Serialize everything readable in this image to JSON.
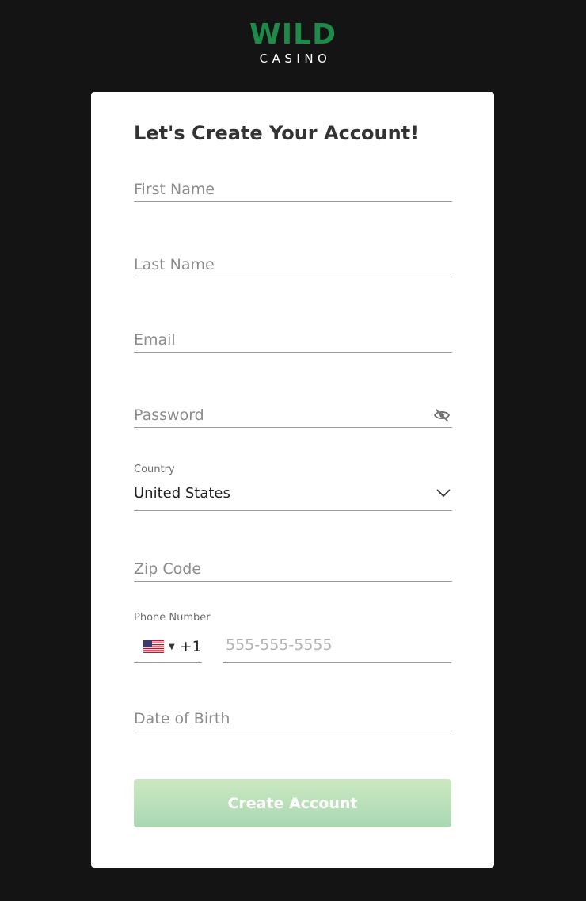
{
  "logo": {
    "primary": "WILD",
    "secondary": "CASINO"
  },
  "colors": {
    "brand_green": "#1e8a4a",
    "page_bg": "#141414",
    "button_gradient_top": "#cbe9c1",
    "button_gradient_bottom": "#a9d7b2"
  },
  "form": {
    "heading": "Let's Create Your Account!",
    "first_name_placeholder": "First Name",
    "last_name_placeholder": "Last Name",
    "email_placeholder": "Email",
    "password_placeholder": "Password",
    "password_toggle_icon": "eye-slash-icon",
    "country_label": "Country",
    "country_value": "United States",
    "zip_placeholder": "Zip Code",
    "phone_label": "Phone Number",
    "phone_flag": "us-flag",
    "phone_code": "+1",
    "phone_placeholder": "555-555-5555",
    "dob_placeholder": "Date of Birth",
    "submit_label": "Create Account"
  }
}
